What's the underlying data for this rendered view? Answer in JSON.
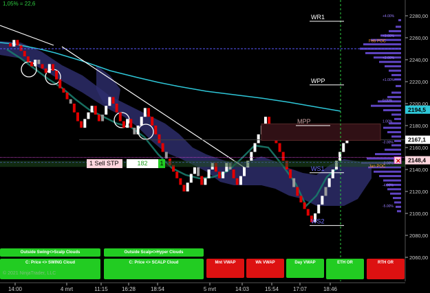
{
  "header": {
    "line1": "1,05% = 22,6"
  },
  "copyright": "© 2021 NinjaTrader, LLC",
  "levels": [
    {
      "name": "WR1",
      "price": 2275
    },
    {
      "name": "WPP",
      "price": 2217
    },
    {
      "name": "MPP",
      "price": 2180
    },
    {
      "name": "WS1",
      "price": 2137
    },
    {
      "name": "WS2",
      "price": 2089
    }
  ],
  "poc": {
    "feb": "Feb POC",
    "jan": "Jan POC"
  },
  "price_labels": {
    "current": "2167,1",
    "vwap": "2194,5",
    "order": "2148,4"
  },
  "order_bar": {
    "label": "1  Sell STP",
    "qty": "182",
    "count": "1",
    "close": "✕"
  },
  "y_axis": {
    "ticks": [
      2280,
      2260,
      2240,
      2220,
      2200,
      2180,
      2160,
      2140,
      2120,
      2100,
      2080,
      2060
    ],
    "labels": [
      "2280,00",
      "2260,00",
      "2240,00",
      "2220,00",
      "2200,00",
      "2180,00",
      "2160,00",
      "2140,00",
      "2120,00",
      "2100,00",
      "2080,00",
      "2060,00"
    ],
    "pct_labels": [
      "+4.00%",
      "+3.00%",
      "+2.00%",
      "+1.00%",
      "0.00%",
      "1.00%",
      "-2.00%",
      "-3.00%",
      "-4.00%",
      "-5.00%"
    ]
  },
  "x_axis": {
    "labels": [
      "14:00",
      "4 mrt",
      "11:15",
      "16:28",
      "18:54",
      "5 mrt",
      "14:03",
      "15:54",
      "17:07",
      "18:46"
    ]
  },
  "buttons": {
    "outside_swing": "Outside Swing<>Scalp Clouds",
    "outside_scalp": "Outside Scalp<>Hyper Clouds",
    "price_swing": "C: Price <> SWING Cloud",
    "price_scalp": "C: Price <> SCALP Cloud",
    "mnt_vwap": "Mnt VWAP",
    "wk_vwap": "Wk VWAP",
    "day_vwap": "Day VWAP",
    "eth_or": "ETH OR",
    "rth_or": "RTH OR"
  },
  "colors": {
    "up": "#ffffff",
    "down": "#e00000",
    "down_dim": "#ff2020",
    "neutral": "#9a9a9a",
    "cyan": "#2ec7d8",
    "cloud": "#3a3a8a",
    "green_btn": "#22cc22",
    "red_btn": "#dd1111",
    "profile": "#6a4dd8"
  }
}
